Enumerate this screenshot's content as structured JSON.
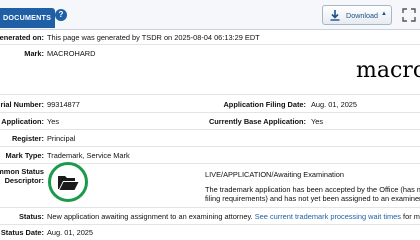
{
  "toolbar": {
    "documents_tab": "DOCUMENTS",
    "help_icon": "?",
    "download_label": "Download",
    "download_caret": "▲",
    "download_icon": "download-icon",
    "accent": "#1f5fa6"
  },
  "record": {
    "generated_label": "enerated on:",
    "generated_value": "This page was generated by TSDR on 2025-08-04 06:13:29 EDT",
    "mark_label": "Mark:",
    "mark_value": "MACROHARD",
    "mark_image_text": "macro",
    "serial_label": "rial Number:",
    "serial_value": "99314877",
    "filing_date_label": "Application Filing Date:",
    "filing_date_value": "Aug. 01, 2025",
    "application_label": "Application:",
    "application_value": "Yes",
    "base_application_label": "Currently Base Application:",
    "base_application_value": "Yes",
    "register_label": "Register:",
    "register_value": "Principal",
    "mark_type_label": "Mark Type:",
    "mark_type_value": "Trademark, Service Mark",
    "status_desc_label_1": "mmon Status",
    "status_desc_label_2": "Descriptor:",
    "status_desc_value": "LIVE/APPLICATION/Awaiting Examination",
    "status_desc_text_1": "The trademark application has been accepted by the Office (has met",
    "status_desc_text_2": "filing requirements) and has not yet been assigned to an examiner.",
    "status_icon": "open-folder-icon",
    "status_ring_color": "#1b9a4b",
    "status_label": "Status:",
    "status_value": "New application awaiting assignment to an examining attorney.",
    "status_link": "See current trademark processing wait times",
    "status_tail": "for more in",
    "status_date_label": "Status Date:",
    "status_date_value": "Aug. 01, 2025"
  }
}
